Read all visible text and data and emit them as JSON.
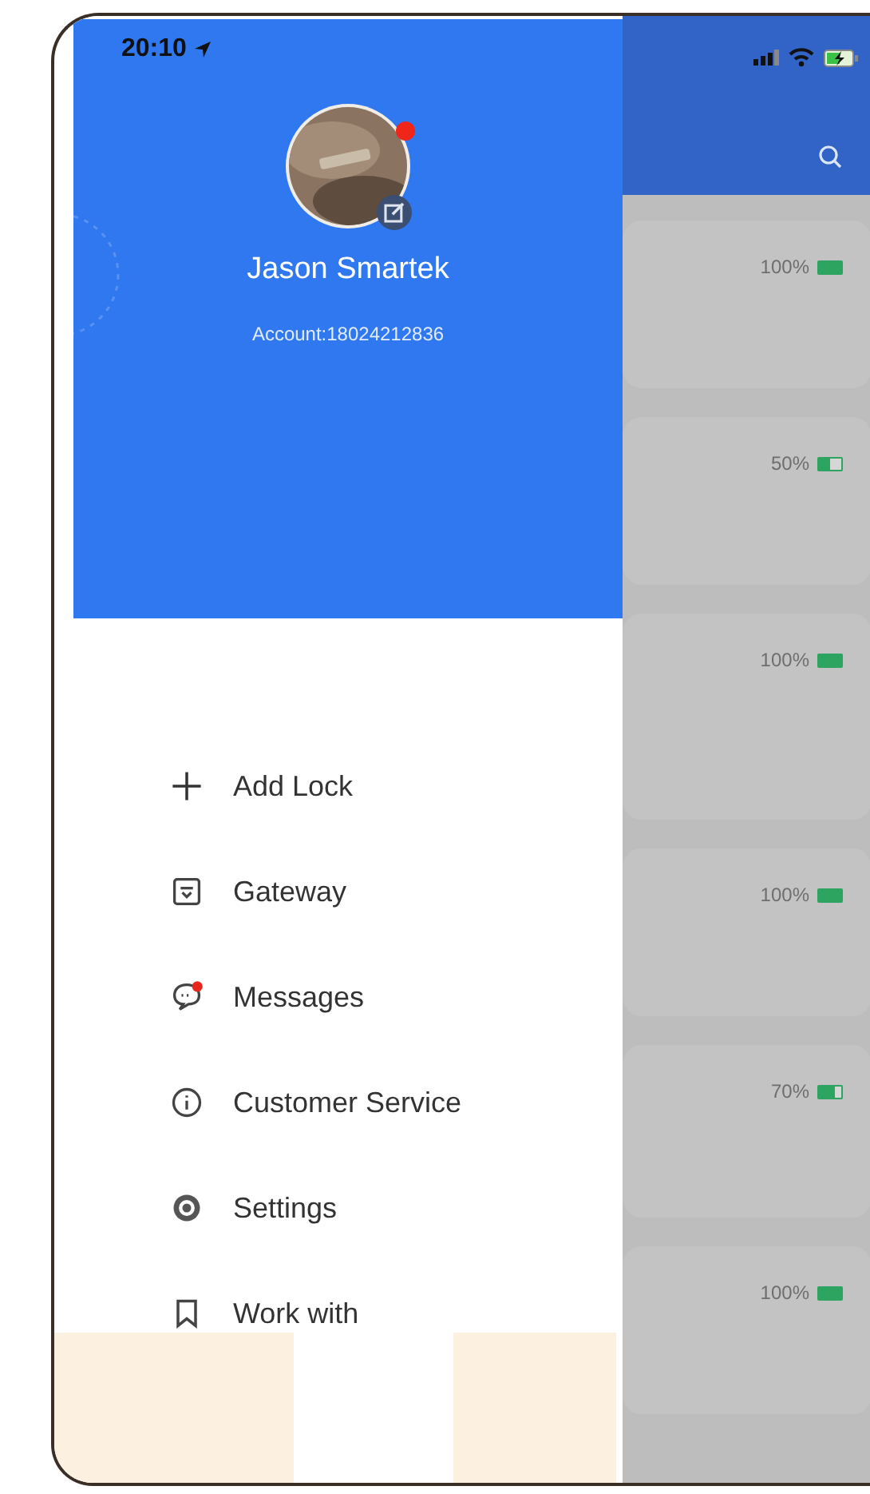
{
  "status_bar": {
    "time": "20:10"
  },
  "profile": {
    "name": "Jason Smartek",
    "account": "Account:18024212836",
    "has_notification": true
  },
  "menu": [
    {
      "label": "Add Lock",
      "kind": "plus",
      "badge": false
    },
    {
      "label": "Gateway",
      "kind": "gateway",
      "badge": false
    },
    {
      "label": "Messages",
      "kind": "messages",
      "badge": true
    },
    {
      "label": "Customer Service",
      "kind": "info",
      "badge": false
    },
    {
      "label": "Settings",
      "kind": "settings",
      "badge": false
    },
    {
      "label": "Work with",
      "kind": "bookmark",
      "badge": false
    }
  ],
  "locks": [
    {
      "reading": "100%",
      "level": 1
    },
    {
      "reading": "50%",
      "level": 0.5
    },
    {
      "reading": "100%",
      "level": 1
    },
    {
      "reading": "100%",
      "level": 1
    },
    {
      "reading": "70%",
      "level": 0.7
    },
    {
      "reading": "100%",
      "level": 1
    }
  ]
}
